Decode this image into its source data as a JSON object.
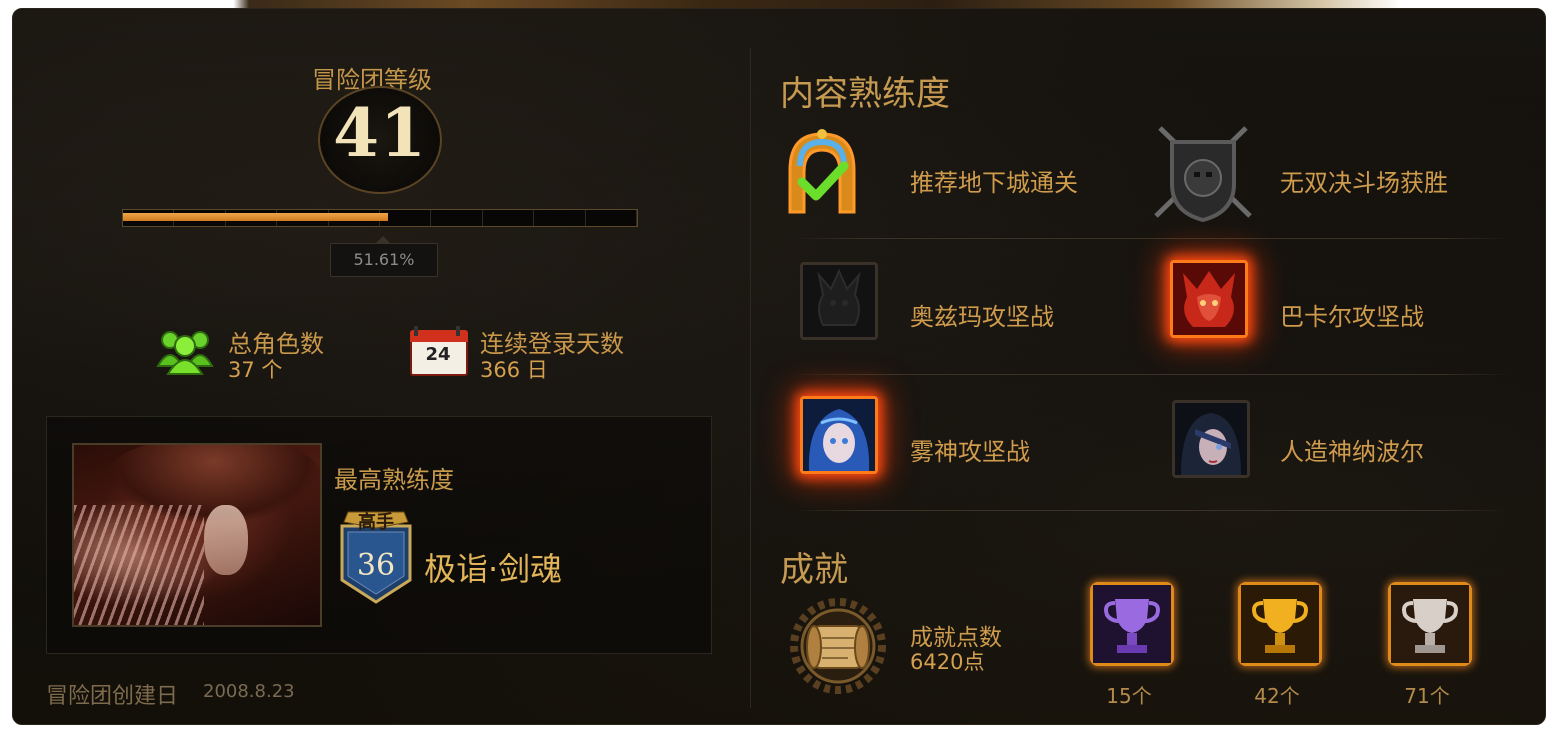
{
  "adventure_group": {
    "level_label": "冒险团等级",
    "level": "41",
    "progress_percent_text": "51.61%",
    "progress_fraction": 0.5161,
    "progress_segments": 10,
    "total_characters_label": "总角色数",
    "total_characters_value": "37 个",
    "login_days_label": "连续登录天数",
    "login_days_value": "366 日",
    "calendar_day": "24",
    "creation_label": "冒险团创建日",
    "creation_date": "2008.8.23"
  },
  "top_character": {
    "label": "最高熟练度",
    "rank_badge": "高手",
    "rank_level": "36",
    "name": "极诣·剑魂"
  },
  "mastery": {
    "title": "内容熟练度",
    "items": [
      {
        "label": "推荐地下城通关",
        "icon": "dungeon-clear-icon",
        "highlight": false
      },
      {
        "label": "无双决斗场获胜",
        "icon": "pvp-arena-icon",
        "highlight": false
      },
      {
        "label": "奥兹玛攻坚战",
        "icon": "ozma-raid-icon",
        "highlight": false
      },
      {
        "label": "巴卡尔攻坚战",
        "icon": "bakal-raid-icon",
        "highlight": true
      },
      {
        "label": "雾神攻坚战",
        "icon": "mist-god-raid-icon",
        "highlight": true
      },
      {
        "label": "人造神纳波尔",
        "icon": "napol-raid-icon",
        "highlight": false
      }
    ]
  },
  "achievements": {
    "title": "成就",
    "points_label": "成就点数",
    "points_value": "6420点",
    "trophies": [
      {
        "count": "15个",
        "icon": "purple-trophy-icon",
        "color": "#8a5ad0"
      },
      {
        "count": "42个",
        "icon": "gold-trophy-icon",
        "color": "#e0a020"
      },
      {
        "count": "71个",
        "icon": "silver-trophy-icon",
        "color": "#c8c0b8"
      }
    ]
  },
  "colors": {
    "accent_gold": "#d9a441",
    "progress_orange": "#e88a2a",
    "glow_red": "#ff4a10"
  }
}
